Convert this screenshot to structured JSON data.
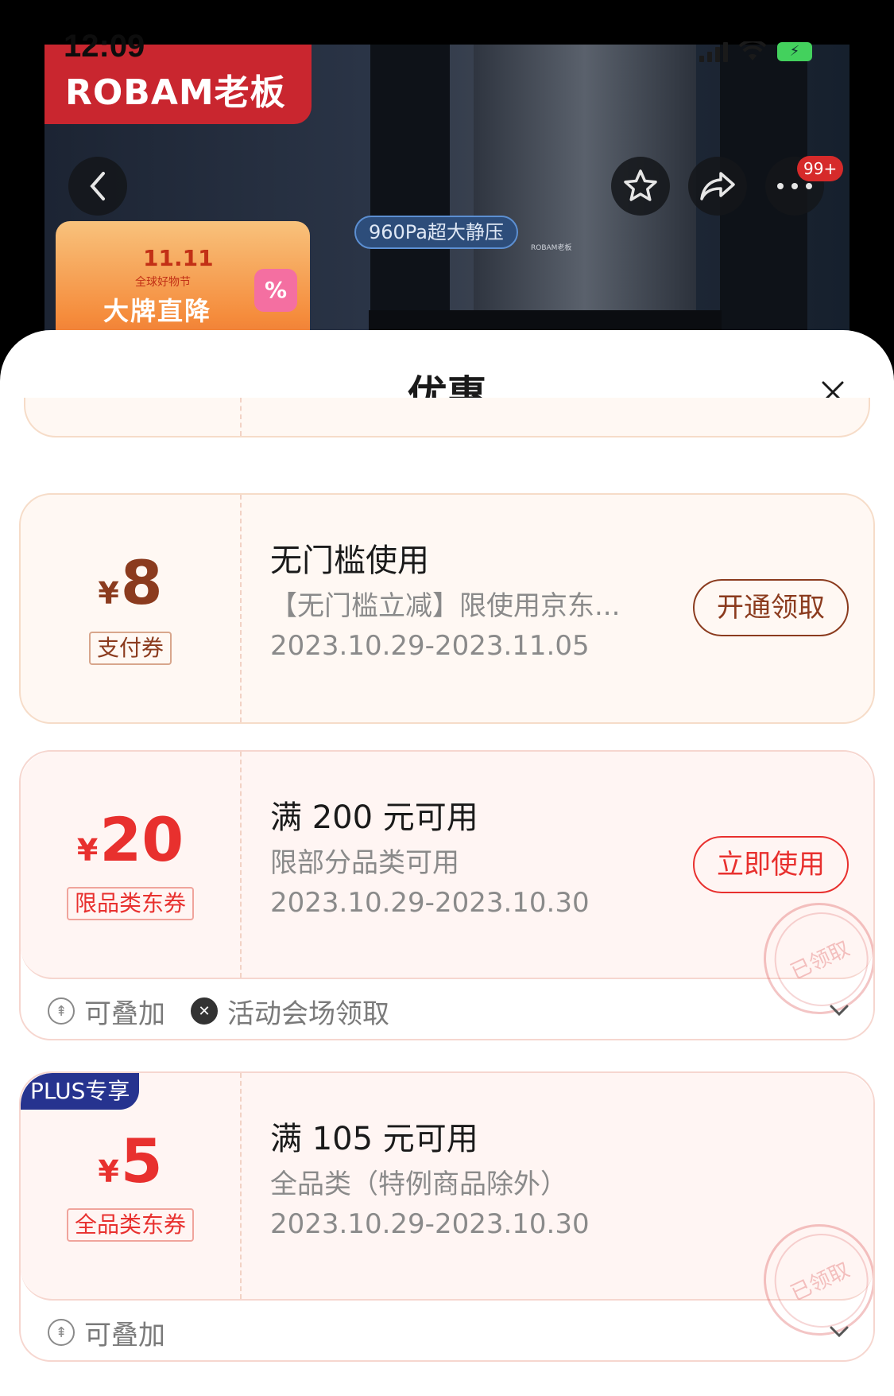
{
  "status_bar": {
    "time": "12:09"
  },
  "hero": {
    "brand": "ROBAM老板",
    "feature_tag": "960Pa超大静压",
    "small_logo": "ROBAM老板",
    "promo": {
      "line1": "11.11",
      "line2": "全球好物节",
      "line3": "大牌直降",
      "icon": "%"
    },
    "more_badge": "99+"
  },
  "sheet": {
    "title": "优惠",
    "coupons": [
      {
        "currency": "¥",
        "amount": "8",
        "tag": "支付券",
        "title": "无门槛使用",
        "desc": "【无门槛立减】限使用京东...",
        "date": "2023.10.29-2023.11.05",
        "button": "开通领取",
        "accent": "#8b3b1e",
        "bg": "#fff8f3"
      },
      {
        "currency": "¥",
        "amount": "20",
        "tag": "限品类东券",
        "title": "满 200 元可用",
        "desc": "限部分品类可用",
        "date": "2023.10.29-2023.10.30",
        "button": "立即使用",
        "stamp": "已领取",
        "footer": [
          "可叠加",
          "活动会场领取"
        ],
        "accent": "#e8302e",
        "bg": "#fff5f3"
      },
      {
        "badge": "PLUS专享",
        "currency": "¥",
        "amount": "5",
        "tag": "全品类东券",
        "title": "满 105 元可用",
        "desc": "全品类（特例商品除外）",
        "date": "2023.10.29-2023.10.30",
        "stamp": "已领取",
        "footer": [
          "可叠加"
        ],
        "accent": "#e8302e",
        "bg": "#fff5f3"
      }
    ]
  }
}
